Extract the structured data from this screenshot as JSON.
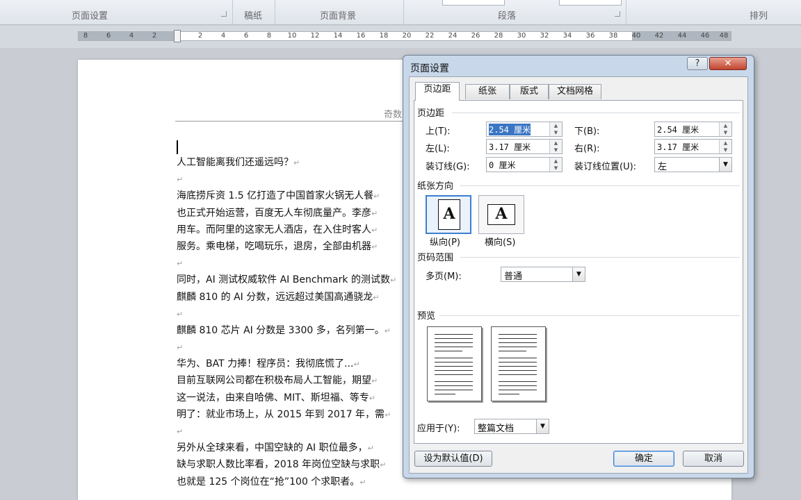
{
  "ribbon": {
    "groups": [
      "页面设置",
      "稿纸",
      "页面背景",
      "段落",
      "排列"
    ]
  },
  "ruler": {
    "left_numbers": [
      "8",
      "6",
      "4",
      "2"
    ],
    "right_numbers": [
      "2",
      "4",
      "6",
      "8",
      "10",
      "12",
      "14",
      "16",
      "18",
      "20",
      "22",
      "24",
      "26",
      "28",
      "30",
      "32",
      "34",
      "36",
      "38",
      "40",
      "42",
      "44",
      "46",
      "48"
    ]
  },
  "document": {
    "header": "奇数",
    "lines": [
      "人工智能离我们还遥远吗？",
      "",
      "海底捞斥资 1.5 亿打造了中国首家火锅无人餐",
      "也正式开始运营，百度无人车彻底量产。李彦",
      "用车。而阿里的这家无人酒店，在入住时客人",
      "服务。乘电梯，吃喝玩乐，退房，全部由机器",
      "",
      "同时，AI 测试权威软件 AI Benchmark 的测试数",
      "麒麟 810 的 AI 分数，远远超过美国高通骁龙",
      "",
      "麒麟 810 芯片 AI 分数是 3300 多，名列第一。",
      "",
      "华为、BAT 力捧！程序员：我彻底慌了...",
      "目前互联网公司都在积极布局人工智能，期望",
      "这一说法，由来自哈佛、MIT、斯坦福、等专",
      "明了：就业市场上，从 2015 年到 2017 年，需",
      "",
      "另外从全球来看，中国空缺的 AI 职位最多，",
      "缺与求职人数比率看，2018 年岗位空缺与求职",
      "也就是 125 个岗位在“抢”100 个求职者。"
    ],
    "paragraph_mark": "↵"
  },
  "dialog": {
    "title": "页面设置",
    "help": "?",
    "close": "✕",
    "tabs": [
      "页边距",
      "纸张",
      "版式",
      "文档网格"
    ],
    "margins": {
      "section": "页边距",
      "top_label": "上(T):",
      "top_value": "2.54 厘米",
      "bottom_label": "下(B):",
      "bottom_value": "2.54 厘米",
      "left_label": "左(L):",
      "left_value": "3.17 厘米",
      "right_label": "右(R):",
      "right_value": "3.17 厘米",
      "gutter_label": "装订线(G):",
      "gutter_value": "0 厘米",
      "gutter_pos_label": "装订线位置(U):",
      "gutter_pos_value": "左"
    },
    "orientation": {
      "section": "纸张方向",
      "portrait": "纵向(P)",
      "landscape": "横向(S)",
      "glyph": "A"
    },
    "pages": {
      "section": "页码范围",
      "multiple_label": "多页(M):",
      "multiple_value": "普通"
    },
    "preview": {
      "section": "预览"
    },
    "apply": {
      "label": "应用于(Y):",
      "value": "整篇文档"
    },
    "buttons": {
      "default": "设为默认值(D)",
      "ok": "确定",
      "cancel": "取消"
    },
    "colors": {
      "title_bar": "#c8d8ea",
      "selection": "#3b76c4",
      "close": "#c0442f"
    }
  }
}
